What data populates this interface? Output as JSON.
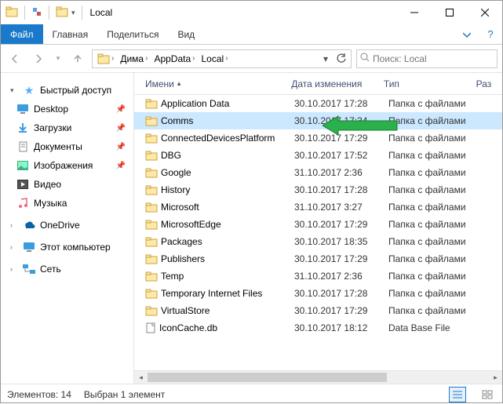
{
  "window": {
    "title": "Local"
  },
  "ribbon": {
    "file": "Файл",
    "tabs": [
      "Главная",
      "Поделиться",
      "Вид"
    ]
  },
  "breadcrumbs": [
    "Дима",
    "AppData",
    "Local"
  ],
  "search": {
    "placeholder": "Поиск: Local"
  },
  "sidebar": {
    "quick_access": "Быстрый доступ",
    "items": [
      {
        "label": "Desktop"
      },
      {
        "label": "Загрузки"
      },
      {
        "label": "Документы"
      },
      {
        "label": "Изображения"
      },
      {
        "label": "Видео"
      },
      {
        "label": "Музыка"
      }
    ],
    "onedrive": "OneDrive",
    "this_pc": "Этот компьютер",
    "network": "Сеть"
  },
  "columns": {
    "name": "Имени",
    "date": "Дата изменения",
    "type": "Тип",
    "size": "Раз"
  },
  "files": [
    {
      "name": "Application Data",
      "date": "30.10.2017 17:28",
      "type": "Папка с файлами",
      "kind": "folder"
    },
    {
      "name": "Comms",
      "date": "30.10.2017 17:34",
      "type": "Папка с файлами",
      "kind": "folder",
      "selected": true
    },
    {
      "name": "ConnectedDevicesPlatform",
      "date": "30.10.2017 17:29",
      "type": "Папка с файлами",
      "kind": "folder"
    },
    {
      "name": "DBG",
      "date": "30.10.2017 17:52",
      "type": "Папка с файлами",
      "kind": "folder"
    },
    {
      "name": "Google",
      "date": "31.10.2017 2:36",
      "type": "Папка с файлами",
      "kind": "folder"
    },
    {
      "name": "History",
      "date": "30.10.2017 17:28",
      "type": "Папка с файлами",
      "kind": "folder"
    },
    {
      "name": "Microsoft",
      "date": "31.10.2017 3:27",
      "type": "Папка с файлами",
      "kind": "folder"
    },
    {
      "name": "MicrosoftEdge",
      "date": "30.10.2017 17:29",
      "type": "Папка с файлами",
      "kind": "folder"
    },
    {
      "name": "Packages",
      "date": "30.10.2017 18:35",
      "type": "Папка с файлами",
      "kind": "folder"
    },
    {
      "name": "Publishers",
      "date": "30.10.2017 17:29",
      "type": "Папка с файлами",
      "kind": "folder"
    },
    {
      "name": "Temp",
      "date": "31.10.2017 2:36",
      "type": "Папка с файлами",
      "kind": "folder"
    },
    {
      "name": "Temporary Internet Files",
      "date": "30.10.2017 17:28",
      "type": "Папка с файлами",
      "kind": "folder"
    },
    {
      "name": "VirtualStore",
      "date": "30.10.2017 17:29",
      "type": "Папка с файлами",
      "kind": "folder"
    },
    {
      "name": "IconCache.db",
      "date": "30.10.2017 18:12",
      "type": "Data Base File",
      "kind": "file"
    }
  ],
  "status": {
    "count": "Элементов: 14",
    "selection": "Выбран 1 элемент"
  }
}
